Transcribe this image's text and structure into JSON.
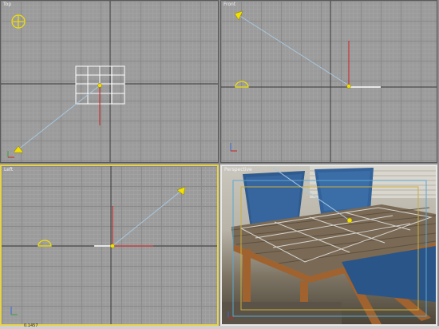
{
  "viewports": {
    "top": {
      "label": "Top"
    },
    "front": {
      "label": "Front"
    },
    "left": {
      "label": "Left"
    },
    "perspective": {
      "label": "Perspective"
    }
  },
  "status": {
    "text": "0.1457"
  },
  "colors": {
    "active_border": "#e8d34a",
    "camera_line": "#a8c8e0",
    "object_yellow": "#f2e000",
    "axis_red": "#d02020",
    "selection_white": "#ffffff"
  },
  "icons": [
    "camera-icon",
    "light-target-icon",
    "axis-gizmo-icon"
  ]
}
